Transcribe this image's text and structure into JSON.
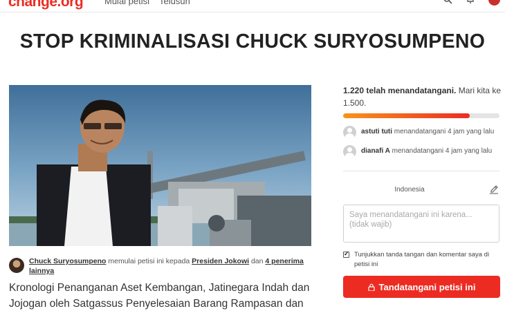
{
  "header": {
    "logo": "change.org",
    "nav": [
      "Mulai petisi",
      "Telusuri"
    ]
  },
  "petition": {
    "title": "STOP KRIMINALISASI CHUCK SURYOSUMPENO",
    "starter_name": "Chuck Suryosumpeno",
    "starter_action": " memulai petisi ini kepada ",
    "recipient": "Presiden Jokowi",
    "and": " dan ",
    "others": "4 penerima lainnya",
    "body_start": "Kronologi Penanganan Aset Kembangan, Jatinegara Indah dan Jojogan oleh Satgassus Penyelesaian Barang Rampasan dan"
  },
  "signatures": {
    "count_text": "1.220 telah menandatangani.",
    "goal_text": " Mari kita ke 1.500.",
    "progress_fraction": 0.81,
    "recent": [
      {
        "name": "astuti tuti",
        "action": " menandatangani 4 jam yang lalu"
      },
      {
        "name": "dianafi A",
        "action": " menandatangani 4 jam yang lalu"
      }
    ]
  },
  "form": {
    "country": "Indonesia",
    "reason_placeholder": "Saya menandatangani ini karena... (tidak wajib)",
    "show_signature_label": "Tunjukkan tanda tangan dan komentar saya di petisi ini",
    "sign_button": "Tandatangani petisi ini"
  },
  "colors": {
    "brand": "#ec2c22",
    "progress_start": "#f7941d",
    "progress_end": "#ec2c22"
  }
}
